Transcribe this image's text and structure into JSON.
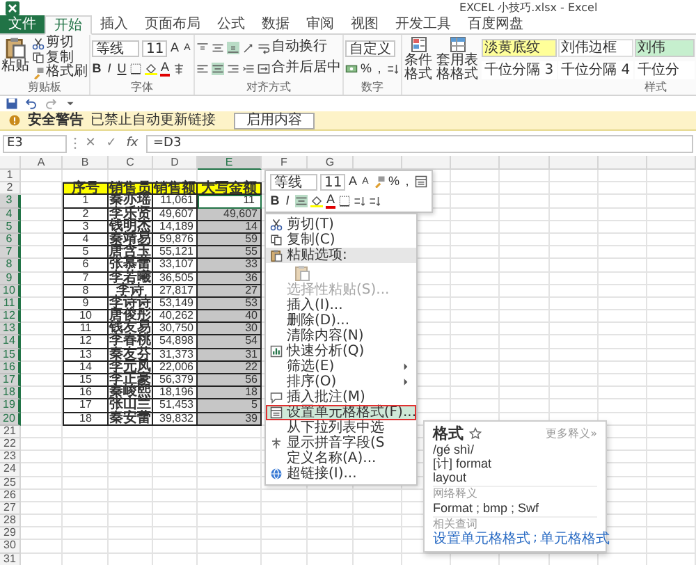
{
  "window": {
    "title": "EXCEL 小技巧.xlsx - Excel"
  },
  "tabs": [
    {
      "label": "文件",
      "kind": "file",
      "selected": false
    },
    {
      "label": "开始",
      "kind": "tab",
      "selected": true
    },
    {
      "label": "插入",
      "kind": "tab",
      "selected": false
    },
    {
      "label": "页面布局",
      "kind": "tab",
      "selected": false
    },
    {
      "label": "公式",
      "kind": "tab",
      "selected": false
    },
    {
      "label": "数据",
      "kind": "tab",
      "selected": false
    },
    {
      "label": "审阅",
      "kind": "tab",
      "selected": false
    },
    {
      "label": "视图",
      "kind": "tab",
      "selected": false
    },
    {
      "label": "开发工具",
      "kind": "tab",
      "selected": false
    },
    {
      "label": "百度网盘",
      "kind": "tab",
      "selected": false
    }
  ],
  "ribbon": {
    "clipboard": {
      "paste": "粘贴",
      "items": [
        "剪切",
        "复制",
        "格式刷"
      ],
      "label": "剪贴板"
    },
    "font": {
      "name": "等线",
      "size": "11",
      "grow": "A",
      "shrink": "A",
      "bold": "B",
      "italic": "I",
      "underline": "U",
      "font_color": "A",
      "label": "字体"
    },
    "alignment": {
      "wrap": "自动换行",
      "merge": "合并后居中",
      "label": "对齐方式"
    },
    "number": {
      "format": "自定义",
      "percent": "%",
      "comma": ",",
      "label": "数字"
    },
    "styles": {
      "conditional": "条件格式",
      "table_format": "套用表格格式",
      "label": "样式",
      "gallery": [
        {
          "label": "淡黄底纹",
          "color": "#ffff99"
        },
        {
          "label": "刘伟边框",
          "color": "#ffffff"
        },
        {
          "label": "刘伟",
          "color": "#c6efce"
        },
        {
          "label": "千位分隔 3",
          "color": "#ffffff"
        },
        {
          "label": "千位分隔 4",
          "color": "#ffffff"
        },
        {
          "label": "千位分",
          "color": "#ffffff"
        }
      ]
    }
  },
  "security_bar": {
    "title": "安全警告",
    "message": "已禁止自动更新链接",
    "button": "启用内容"
  },
  "formula_bar": {
    "name_box": "E3",
    "cancel": "✕",
    "enter": "✓",
    "fx": "fx",
    "formula": "=D3"
  },
  "sheet": {
    "columns": [
      {
        "label": "A",
        "selected": false
      },
      {
        "label": "B",
        "selected": false
      },
      {
        "label": "C",
        "selected": false
      },
      {
        "label": "D",
        "selected": false
      },
      {
        "label": "E",
        "selected": true
      },
      {
        "label": "F",
        "selected": false
      },
      {
        "label": "G",
        "selected": false
      }
    ],
    "top_rows": [
      "1"
    ],
    "header_row": {
      "num": "2",
      "cells": [
        "",
        "序号",
        "销售员",
        "销售额",
        "大写金额"
      ]
    },
    "rows": [
      {
        "num": "3",
        "cells": [
          "",
          "1",
          "秦亦瑶",
          "11,061",
          "11"
        ],
        "selected": true,
        "active": true
      },
      {
        "num": "4",
        "cells": [
          "",
          "2",
          "李乐贤",
          "49,607",
          "49,607"
        ],
        "selected": true,
        "active": false
      },
      {
        "num": "5",
        "cells": [
          "",
          "3",
          "钱明杰",
          "14,189",
          "14"
        ],
        "selected": true,
        "active": false
      },
      {
        "num": "6",
        "cells": [
          "",
          "4",
          "秦靖易",
          "59,876",
          "59"
        ],
        "selected": true,
        "active": false
      },
      {
        "num": "7",
        "cells": [
          "",
          "5",
          "唐含玉",
          "55,121",
          "55"
        ],
        "selected": true,
        "active": false
      },
      {
        "num": "8",
        "cells": [
          "",
          "6",
          "张慕蕾",
          "33,107",
          "33"
        ],
        "selected": true,
        "active": false
      },
      {
        "num": "9",
        "cells": [
          "",
          "7",
          "李若曦",
          "36,505",
          "36"
        ],
        "selected": true,
        "active": false
      },
      {
        "num": "10",
        "cells": [
          "",
          "8",
          "李诗",
          "27,817",
          "27"
        ],
        "selected": true,
        "active": false
      },
      {
        "num": "11",
        "cells": [
          "",
          "9",
          "李诗诗",
          "53,149",
          "53"
        ],
        "selected": true,
        "active": false
      },
      {
        "num": "12",
        "cells": [
          "",
          "10",
          "唐俊彤",
          "40,262",
          "40"
        ],
        "selected": true,
        "active": false
      },
      {
        "num": "13",
        "cells": [
          "",
          "11",
          "钱友易",
          "30,750",
          "30"
        ],
        "selected": true,
        "active": false
      },
      {
        "num": "14",
        "cells": [
          "",
          "12",
          "李春桃",
          "54,898",
          "54"
        ],
        "selected": true,
        "active": false
      },
      {
        "num": "15",
        "cells": [
          "",
          "13",
          "秦友芬",
          "31,373",
          "31"
        ],
        "selected": true,
        "active": false
      },
      {
        "num": "16",
        "cells": [
          "",
          "14",
          "李元凤",
          "22,006",
          "22"
        ],
        "selected": true,
        "active": false
      },
      {
        "num": "17",
        "cells": [
          "",
          "15",
          "李正豪",
          "56,379",
          "56"
        ],
        "selected": true,
        "active": false
      },
      {
        "num": "18",
        "cells": [
          "",
          "16",
          "秦峻熙",
          "18,196",
          "18"
        ],
        "selected": true,
        "active": false
      },
      {
        "num": "19",
        "cells": [
          "",
          "17",
          "张山兰",
          "51,453",
          "5"
        ],
        "selected": true,
        "active": false
      },
      {
        "num": "20",
        "cells": [
          "",
          "18",
          "秦安蕾",
          "39,832",
          "39"
        ],
        "selected": true,
        "active": false
      }
    ],
    "bottom_rows": [
      "21",
      "22",
      "23",
      "24",
      "25",
      "26",
      "27",
      "28",
      "29",
      "30",
      "31"
    ]
  },
  "mini_toolbar": {
    "font": "等线",
    "size": "11",
    "grow": "A",
    "shrink": "A",
    "percent": "%",
    "comma": ",",
    "bold": "B",
    "italic": "I",
    "font_color": "A"
  },
  "context_menu": [
    {
      "kind": "item",
      "label": "剪切(T)",
      "disabled": false,
      "selected": false,
      "submenu": false,
      "outlined": false
    },
    {
      "kind": "item",
      "label": "复制(C)",
      "disabled": false,
      "selected": false,
      "submenu": false,
      "outlined": false
    },
    {
      "kind": "header",
      "label": "粘贴选项:"
    },
    {
      "kind": "paste-icons"
    },
    {
      "kind": "item",
      "label": "选择性粘贴(S)...",
      "disabled": true,
      "selected": false,
      "submenu": false,
      "outlined": false
    },
    {
      "kind": "item",
      "label": "插入(I)...",
      "disabled": false,
      "selected": false,
      "submenu": false,
      "outlined": false
    },
    {
      "kind": "item",
      "label": "删除(D)...",
      "disabled": false,
      "selected": false,
      "submenu": false,
      "outlined": false
    },
    {
      "kind": "item",
      "label": "清除内容(N)",
      "disabled": false,
      "selected": false,
      "submenu": false,
      "outlined": false
    },
    {
      "kind": "item",
      "label": "快速分析(Q)",
      "disabled": false,
      "selected": false,
      "submenu": false,
      "outlined": false
    },
    {
      "kind": "item",
      "label": "筛选(E)",
      "disabled": false,
      "selected": false,
      "submenu": true,
      "outlined": false
    },
    {
      "kind": "item",
      "label": "排序(O)",
      "disabled": false,
      "selected": false,
      "submenu": true,
      "outlined": false
    },
    {
      "kind": "item",
      "label": "插入批注(M)",
      "disabled": false,
      "selected": false,
      "submenu": false,
      "outlined": false
    },
    {
      "kind": "item",
      "label": "设置单元格格式(F)...",
      "disabled": false,
      "selected": true,
      "submenu": false,
      "outlined": true
    },
    {
      "kind": "item",
      "label": "从下拉列表中选",
      "disabled": false,
      "selected": false,
      "submenu": false,
      "outlined": false
    },
    {
      "kind": "item",
      "label": "显示拼音字段(S",
      "disabled": false,
      "selected": false,
      "submenu": false,
      "outlined": false
    },
    {
      "kind": "item",
      "label": "定义名称(A)...",
      "disabled": false,
      "selected": false,
      "submenu": false,
      "outlined": false
    },
    {
      "kind": "item",
      "label": "超链接(I)...",
      "disabled": false,
      "selected": false,
      "submenu": false,
      "outlined": false
    }
  ],
  "dictionary_popup": {
    "word": "格式",
    "more": "更多释义»",
    "pinyin": "/gé shì/",
    "definitions": [
      "[计] format",
      "layout"
    ],
    "web_label": "网络释义",
    "web": "Format ; bmp ; Swf",
    "related_label": "相关查词",
    "related": [
      "设置单元格格式",
      "单元格格式"
    ],
    "related_separator": ";"
  }
}
